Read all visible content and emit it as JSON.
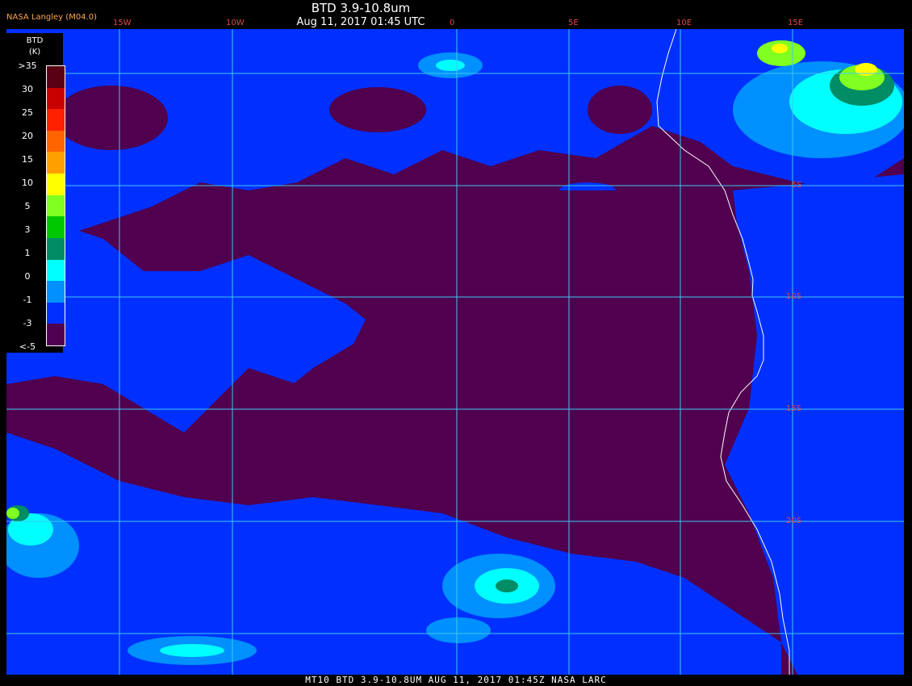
{
  "header": {
    "title": "BTD 3.9-10.8um",
    "subtitle": "Aug 11, 2017 01:45 UTC",
    "credit": "NASA Langley (M04.0)"
  },
  "footer": {
    "text": "MT10  BTD 3.9-10.8UM   AUG 11, 2017 01:45Z   NASA LARC"
  },
  "grid": {
    "longitude_labels": [
      "15W",
      "10W",
      "0",
      "5E",
      "10E",
      "15E"
    ],
    "latitude_labels": [
      "5S",
      "10S",
      "15S",
      "20S"
    ],
    "color": "#40c8f0",
    "label_color": "#e04848"
  },
  "legend": {
    "title": "BTD",
    "unit": "(K)",
    "labels": [
      ">35",
      "30",
      "25",
      "20",
      "15",
      "10",
      "5",
      "3",
      "1",
      "0",
      "-1",
      "-3",
      "<-5"
    ],
    "colors": [
      "#5a0014",
      "#c80000",
      "#ff2000",
      "#ff6400",
      "#ffa000",
      "#ffff00",
      "#80ff20",
      "#00c800",
      "#008c64",
      "#00ffff",
      "#0090ff",
      "#0030ff",
      "#500050"
    ]
  },
  "map": {
    "background_color": "#50004e",
    "low_cloud_color": "#0030ff",
    "coastline_color": "#ffffff"
  }
}
